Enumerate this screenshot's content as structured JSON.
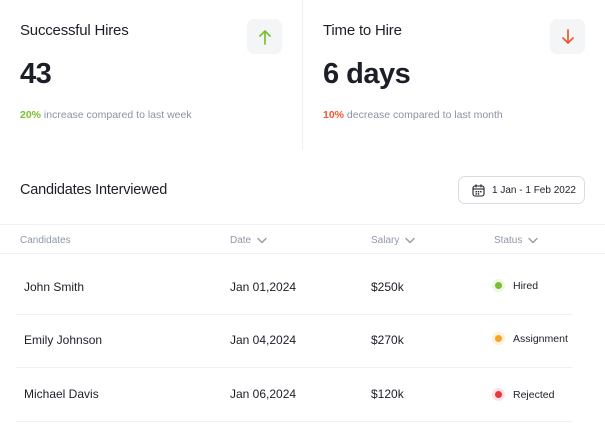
{
  "kpis": {
    "hires": {
      "title": "Successful Hires",
      "value": "43",
      "pct": "20%",
      "note": " increase compared to last week",
      "trend": "up",
      "color": "#7bbf2f"
    },
    "time": {
      "title": "Time to Hire",
      "value": "6 days",
      "pct": "10%",
      "note": " decrease compared to last month",
      "trend": "down",
      "color": "#f0572e"
    }
  },
  "section": {
    "title": "Candidates Interviewed",
    "date_range": "1 Jan - 1 Feb 2022"
  },
  "table": {
    "headers": {
      "candidates": "Candidates",
      "date": "Date",
      "salary": "Salary",
      "status": "Status"
    },
    "rows": [
      {
        "name": "John Smith",
        "date": "Jan 01,2024",
        "salary": "$250k",
        "status": "Hired",
        "status_color": "#7bbf2f",
        "ring_color": "#eef6e4"
      },
      {
        "name": "Emily Johnson",
        "date": "Jan 04,2024",
        "salary": "$270k",
        "status": "Assignment",
        "status_color": "#f5a623",
        "ring_color": "#fdf1dc"
      },
      {
        "name": "Michael Davis",
        "date": "Jan 06,2024",
        "salary": "$120k",
        "status": "Rejected",
        "status_color": "#e8373f",
        "ring_color": "#fde3e4"
      }
    ]
  }
}
